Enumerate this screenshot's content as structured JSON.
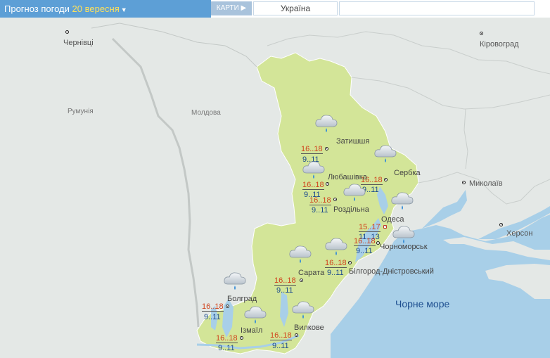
{
  "header": {
    "title": "Прогноз погоди",
    "date": "20 вересня",
    "maps_tab": "КАРТИ",
    "region": "Україна"
  },
  "map_labels": {
    "chernivtsi": "Чернівці",
    "kirovohrad": "Кіровоград",
    "romania": "Румунія",
    "moldova": "Молдова",
    "mykolaiv": "Миколаїв",
    "kherson": "Херсон",
    "black_sea": "Чорне море"
  },
  "forecast": [
    {
      "id": "zatyshshia",
      "name": "Затишшя",
      "max": "16..18",
      "min": "9..11",
      "icon": "cloud-rain-icon"
    },
    {
      "id": "serbka",
      "name": "Сербка",
      "max": "16..18",
      "min": "9..11",
      "icon": "cloud-rain-icon"
    },
    {
      "id": "liubashivka",
      "name": "Любашівка",
      "max": "16..18",
      "min": "9..11",
      "icon": "cloud-rain-icon"
    },
    {
      "id": "rozdilna",
      "name": "Роздільна",
      "max": "16..18",
      "min": "9..11",
      "icon": "cloud-rain-icon"
    },
    {
      "id": "odesa",
      "name": "Одеса",
      "max": "15..17",
      "min": "11..13",
      "icon": "cloud-rain-icon"
    },
    {
      "id": "chornomorsk",
      "name": "Чорноморськ",
      "max": "16..18",
      "min": "9..11",
      "icon": "cloud-rain-icon"
    },
    {
      "id": "bilhorod",
      "name": "Білгород-Дністровський",
      "max": "16..18",
      "min": "9..11",
      "icon": "cloud-rain-icon"
    },
    {
      "id": "sarata",
      "name": "Сарата",
      "max": "16..18",
      "min": "9..11",
      "icon": "cloud-rain-icon"
    },
    {
      "id": "bolhrad",
      "name": "Болград",
      "max": "16..18",
      "min": "9..11",
      "icon": "cloud-rain-icon"
    },
    {
      "id": "izmail",
      "name": "Ізмаїл",
      "max": "16..18",
      "min": "9..11",
      "icon": "cloud-rain-icon"
    },
    {
      "id": "vylkove",
      "name": "Вилкове",
      "max": "16..18",
      "min": "9..11",
      "icon": "cloud-rain-icon"
    }
  ],
  "colors": {
    "header_blue": "#5d9fd6",
    "date_yellow": "#ffe15a",
    "region_fill": "#d3e598",
    "sea": "#a8cfe8",
    "land": "#e4e8e6",
    "temp_max": "#d0421b",
    "temp_min": "#1c4b8f"
  }
}
